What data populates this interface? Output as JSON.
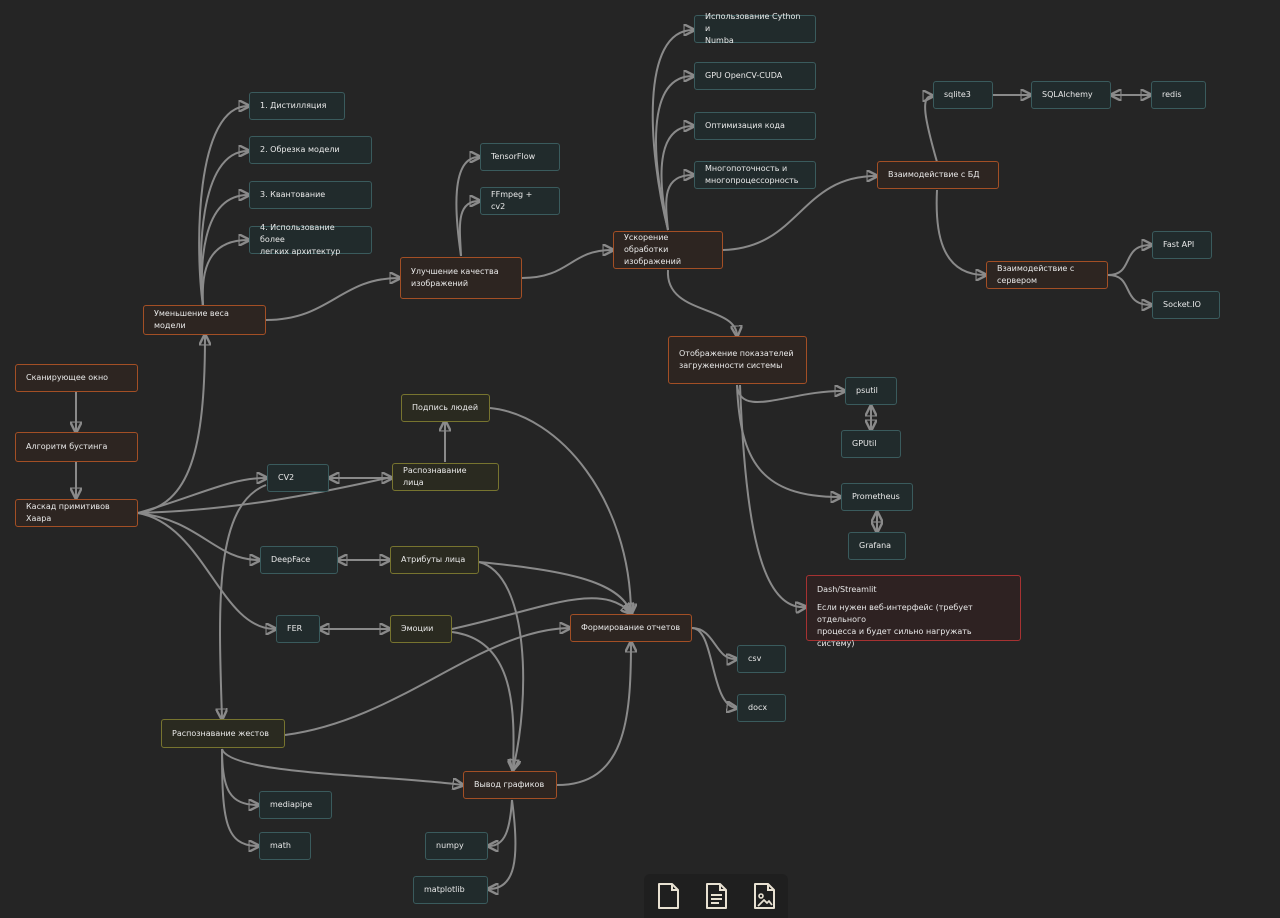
{
  "diagram": {
    "nodes": {
      "scan": "Сканирующее окно",
      "boost": "Алгоритм бустинга",
      "haar": "Каскад примитивов\nХаара",
      "weight": "Уменьшение веса\nмодели",
      "distil": "1. Дистилляция",
      "prune": "2. Обрезка модели",
      "quant": "3. Квантование",
      "light": "4. Использование более\nлегких архитектур",
      "improve": "Улучшение качества\nизображений",
      "tf": "TensorFlow",
      "ffmpeg": "FFmpeg + cv2",
      "accel": "Ускорение обработки\nизображений",
      "cython": "Использование Cython и\nNumba",
      "gpu": "GPU OpenCV-CUDA",
      "opt": "Оптимизация кода",
      "multi": "Многопоточность и\nмногопроцессорность",
      "db": "Взаимодействие с БД",
      "sqlite": "sqlite3",
      "sqla": "SQLAlchemy",
      "redis": "redis",
      "server": "Взаимодействие с\nсервером",
      "fastapi": "Fast API",
      "socketio": "Socket.IO",
      "monitor": "Отображение показателей\nзагруженности системы",
      "psutil": "psutil",
      "gputil": "GPUtil",
      "prom": "Prometheus",
      "grafana": "Grafana",
      "dash_title": "Dash/Streamlit",
      "dash_note": "Если нужен веб-интерфейс (требует отдельного\nпроцесса и будет сильно нагружать систему)",
      "sign": "Подпись людей",
      "cv2": "CV2",
      "face": "Распознавание лица",
      "deepface": "DeepFace",
      "attrs": "Атрибуты лица",
      "fer": "FER",
      "emotions": "Эмоции",
      "reports": "Формирование отчетов",
      "csv": "csv",
      "docx": "docx",
      "gestures": "Распознавание жестов",
      "mediapipe": "mediapipe",
      "math": "math",
      "plots": "Вывод графиков",
      "numpy": "numpy",
      "matplotlib": "matplotlib"
    }
  },
  "toolbar": {
    "icons": [
      "blank-page-icon",
      "text-document-icon",
      "image-document-icon"
    ]
  }
}
